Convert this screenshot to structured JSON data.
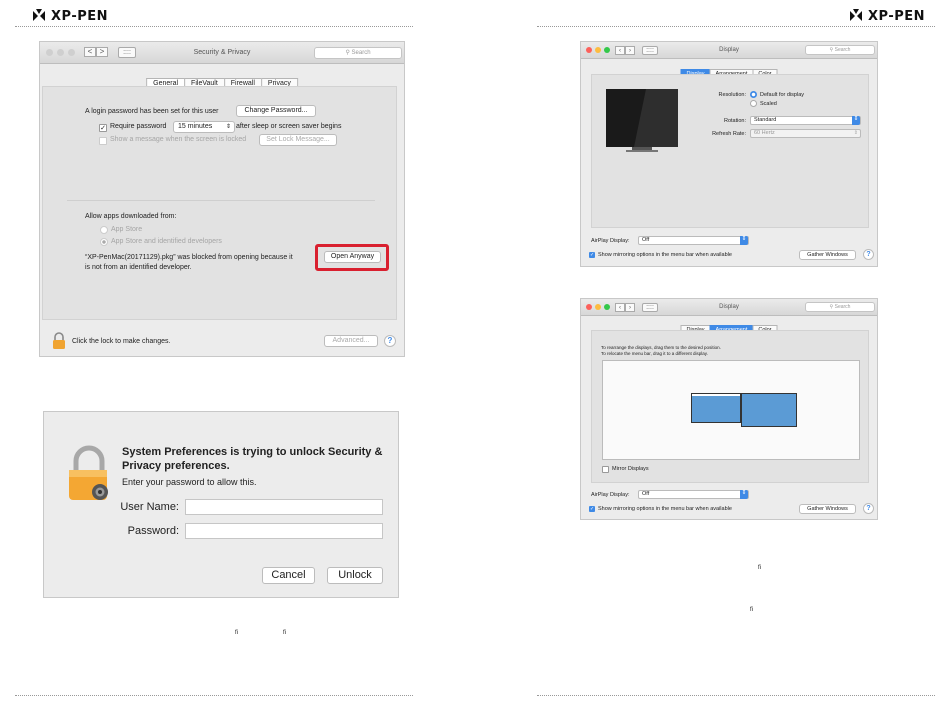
{
  "header": {
    "brand": "XP-PEN"
  },
  "security_window": {
    "title": "Security & Privacy",
    "search_placeholder": "Search",
    "nav_back": "<",
    "nav_fwd": ">",
    "grid_label": "::::",
    "tabs": [
      "General",
      "FileVault",
      "Firewall",
      "Privacy"
    ],
    "login_text": "A login password has been set for this user",
    "change_password": "Change Password...",
    "require_password_label": "Require password",
    "require_password_value": "15 minutes",
    "after_sleep": "after sleep or screen saver begins",
    "show_message_label": "Show a message when the screen is locked",
    "set_lock_message": "Set Lock Message...",
    "allow_apps": "Allow apps downloaded from:",
    "option_app_store": "App Store",
    "option_identified": "App Store and identified developers",
    "blocked_line1": "“XP-PenMac(20171129).pkg” was blocked from opening because it",
    "blocked_line2": "is not from an identified developer.",
    "open_anyway": "Open Anyway",
    "lock_text": "Click the lock to make changes.",
    "advanced": "Advanced...",
    "help": "?",
    "highlight_color": "#d9202f"
  },
  "unlock_dialog": {
    "heading_line1": "System Preferences is trying to unlock Security &",
    "heading_line2": "Privacy preferences.",
    "subtext": "Enter your password to allow this.",
    "username_label": "User Name:",
    "password_label": "Password:",
    "username_value": "",
    "password_value": "",
    "cancel": "Cancel",
    "unlock": "Unlock"
  },
  "footnote_left": {
    "a": "fi",
    "b": "fi"
  },
  "display_window": {
    "title": "Display",
    "search_placeholder": "Search",
    "tabs": [
      "Display",
      "Arrangement",
      "Color"
    ],
    "resolution_label": "Resolution:",
    "resolution_default": "Default for display",
    "resolution_scaled": "Scaled",
    "rotation_label": "Rotation:",
    "rotation_value": "Standard",
    "refresh_label": "Refresh Rate:",
    "refresh_value": "60 Hertz",
    "airplay_label": "AirPlay Display:",
    "airplay_value": "Off",
    "mirroring_label": "Show mirroring options in the menu bar when available",
    "gather_windows": "Gather Windows",
    "help": "?"
  },
  "arrangement_window": {
    "title": "Display",
    "search_placeholder": "Search",
    "tabs": [
      "Display",
      "Arrangement",
      "Color"
    ],
    "instruction1": "To rearrange the displays, drag them to the desired position.",
    "instruction2": "To relocate the menu bar, drag it to a different display.",
    "mirror_displays": "Mirror Displays",
    "airplay_label": "AirPlay Display:",
    "airplay_value": "Off",
    "mirroring_label": "Show mirroring options in the menu bar when available",
    "gather_windows": "Gather Windows",
    "help": "?",
    "display_color": "#5b9bd5"
  },
  "footnote_right": {
    "a": "fi",
    "b": "fi"
  },
  "colors": {
    "accent": "#3f8ae6",
    "traffic_red": "#fc605b",
    "traffic_yellow": "#fdbc40",
    "traffic_green": "#34c84a"
  }
}
